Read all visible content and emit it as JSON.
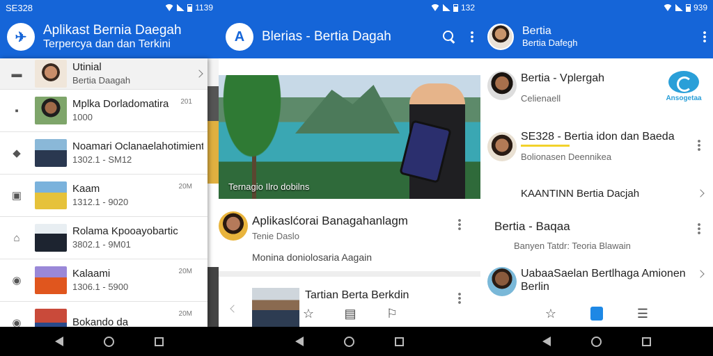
{
  "screens": [
    {
      "status": {
        "carrier": "SE328",
        "time": "1139"
      },
      "appbar": {
        "title": "Aplikast Bernia Daegah",
        "subtitle": "Terpercya dan dan Terkini"
      },
      "items": [
        {
          "icon": "menu-icon",
          "title": "Utinial",
          "subtitle": "Bertia Daagah",
          "meta": "",
          "chevron": true
        },
        {
          "icon": "chat-icon",
          "title": "Mplka Dorladomatira",
          "subtitle": "1000",
          "meta": "201",
          "chevron": false
        },
        {
          "icon": "badge-icon",
          "title": "Noamari Oclanaelahotimient",
          "subtitle": "1302.1 - SM12",
          "meta": "",
          "chevron": false
        },
        {
          "icon": "tablet-icon",
          "title": "Kaam",
          "subtitle": "1312.1 - 9020",
          "meta": "20M",
          "chevron": false
        },
        {
          "icon": "home-icon",
          "title": "Rolama Kpooayobartic",
          "subtitle": "3802.1 - 9M01",
          "meta": "",
          "chevron": false
        },
        {
          "icon": "camera-icon",
          "title": "Kalaami",
          "subtitle": "1306.1 - 5900",
          "meta": "20M",
          "chevron": false
        },
        {
          "icon": "camera-icon",
          "title": "Bokando da",
          "subtitle": "",
          "meta": "20M",
          "chevron": false
        }
      ]
    },
    {
      "status": {
        "time": "132"
      },
      "appbar": {
        "title": "Blerias - Bertia Dagah"
      },
      "hero_caption": "Ternagio Ilro dobilns",
      "card": {
        "title": "Aplikaslćorai Banagahanlagm",
        "subtitle": "Tenie Daslo",
        "description": "Monina doniolosaria Aagain"
      },
      "row": {
        "title": "Tartian Berta Berkdin"
      }
    },
    {
      "status": {
        "time": "939"
      },
      "appbar": {
        "title": "Bertia",
        "subtitle": "Bertia Dafegh"
      },
      "badge": "Ansogetaa",
      "items": [
        {
          "title": "Bertia - Vplergah",
          "subtitle": "Celienaell"
        },
        {
          "title": "SE328 - Bertia idon dan Baeda",
          "subtitle": "Bolionasen Deennikea"
        },
        {
          "title": "KAANTINN Bertia Dacjah",
          "subtitle": ""
        },
        {
          "title": "Bertia - Baqaa",
          "subtitle": "Banyen Tatdr: Teoria Blawain"
        },
        {
          "title": "UabaaSaelan Bertlhaga Amionen Berlin",
          "subtitle": ""
        }
      ]
    }
  ]
}
